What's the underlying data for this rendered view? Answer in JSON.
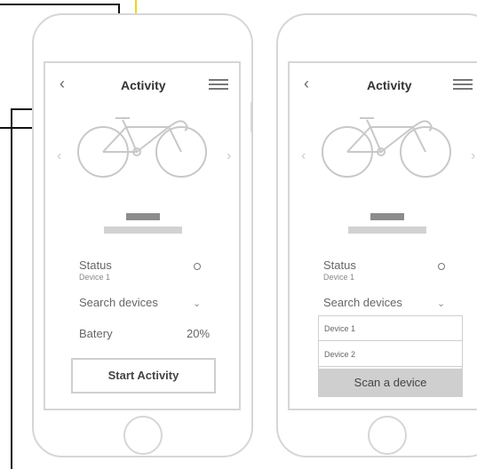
{
  "phones": [
    {
      "header": {
        "title": "Activity"
      },
      "status": {
        "label": "Status",
        "device": "Device 1"
      },
      "search": {
        "label": "Search devices"
      },
      "battery": {
        "label": "Batery",
        "value": "20%"
      },
      "start_button": {
        "label": "Start Activity"
      }
    },
    {
      "header": {
        "title": "Activity"
      },
      "status": {
        "label": "Status",
        "device": "Device 1"
      },
      "search": {
        "label": "Search devices"
      },
      "dropdown": {
        "options": [
          "Device 1",
          "Device 2"
        ],
        "scan_label": "Scan a device"
      }
    }
  ],
  "icons": {
    "back": "chevron-left-icon",
    "menu": "hamburger-menu-icon",
    "status": "status-circle-icon",
    "expand": "chevron-down-icon",
    "carousel_prev": "chevron-left-icon",
    "carousel_next": "chevron-right-icon"
  },
  "colors": {
    "annotation_line": "#111111",
    "annotation_highlight": "#f2d31b",
    "frame": "#d6d6d6",
    "scan_button_bg": "#cfcfcf"
  }
}
